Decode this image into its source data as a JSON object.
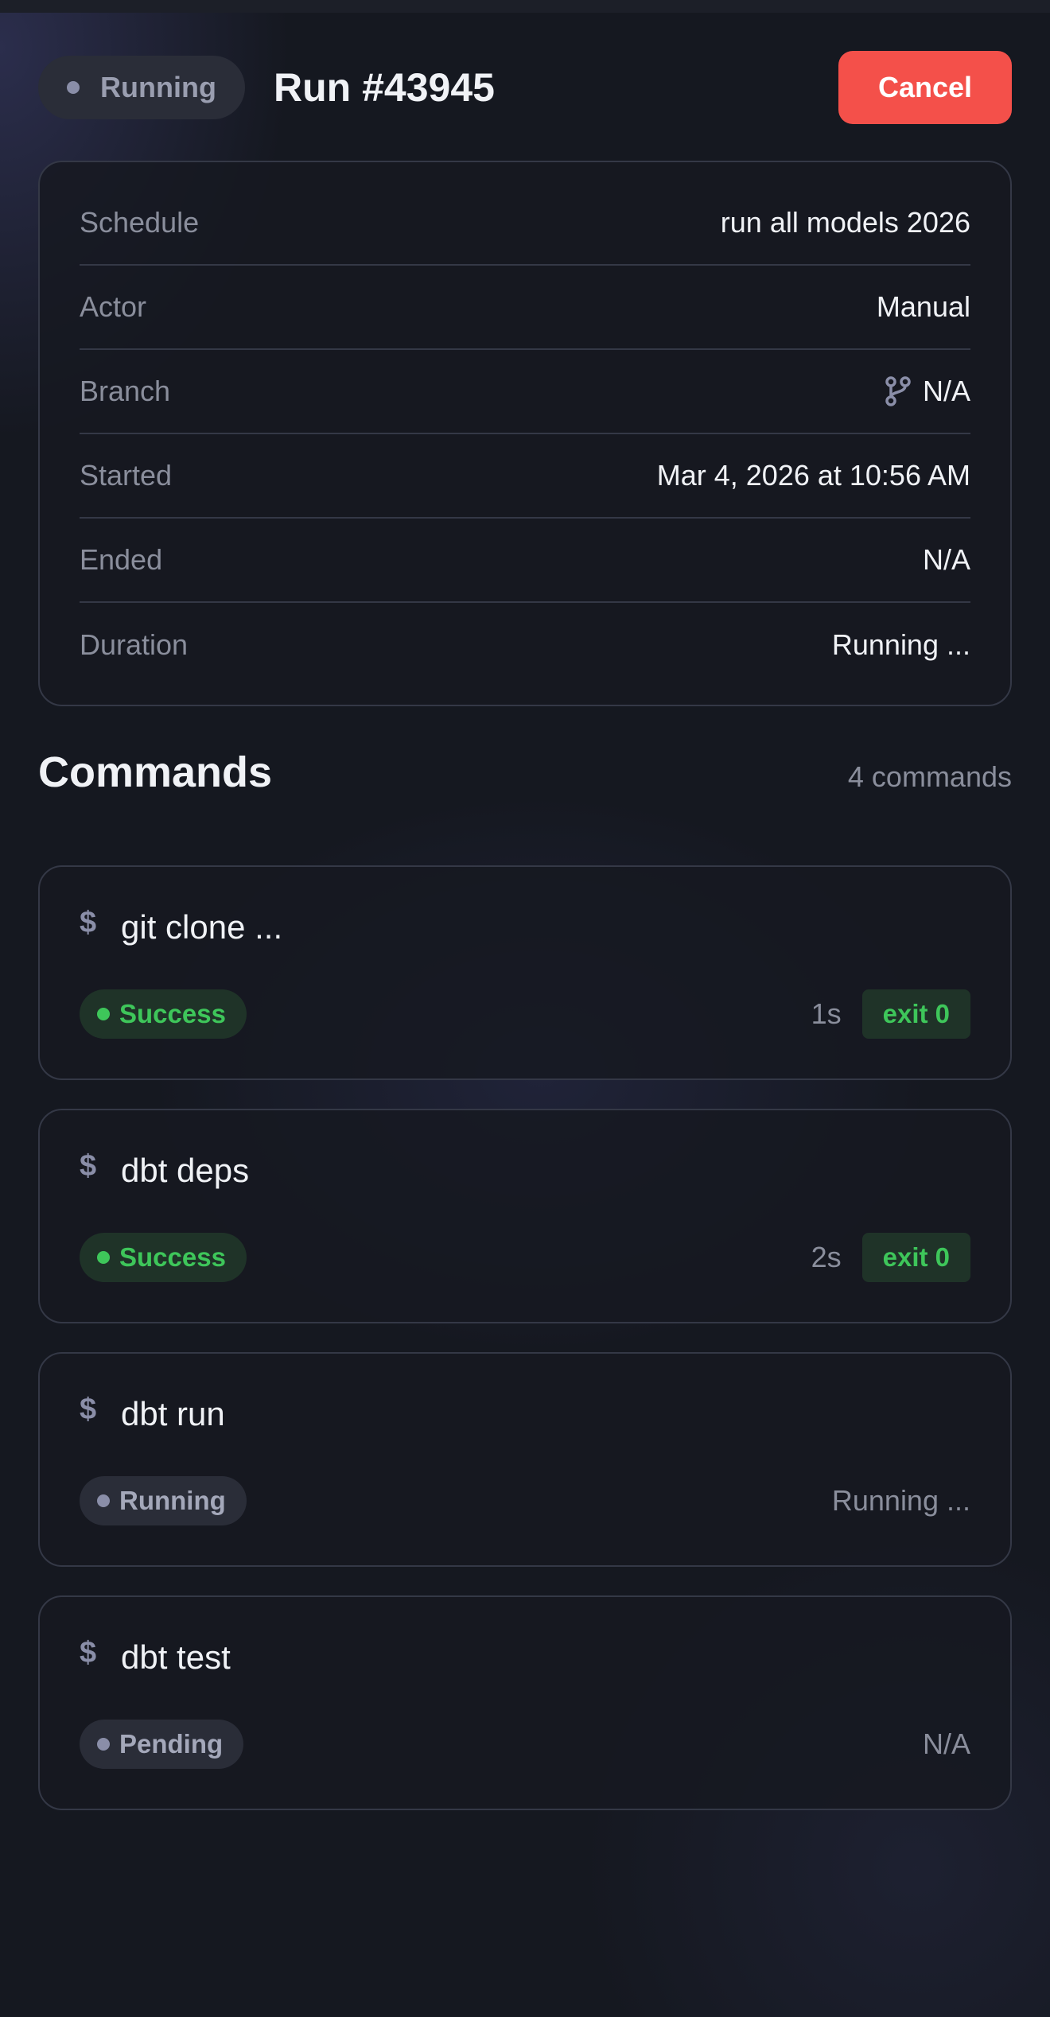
{
  "header": {
    "status": "Running",
    "title": "Run #43945",
    "cancel_label": "Cancel"
  },
  "details": [
    {
      "key": "Schedule",
      "value": "run all models 2026"
    },
    {
      "key": "Actor",
      "value": "Manual"
    },
    {
      "key": "Branch",
      "value": "N/A",
      "icon": "git-branch-icon"
    },
    {
      "key": "Started",
      "value": "Mar 4, 2026 at 10:56 AM"
    },
    {
      "key": "Ended",
      "value": "N/A"
    },
    {
      "key": "Duration",
      "value": "Running ..."
    }
  ],
  "commands": {
    "title": "Commands",
    "count_label": "4 commands",
    "items": [
      {
        "prompt": "$",
        "command": "git clone ...",
        "status": "Success",
        "duration": "1s",
        "exit": "exit 0"
      },
      {
        "prompt": "$",
        "command": "dbt deps",
        "status": "Success",
        "duration": "2s",
        "exit": "exit 0"
      },
      {
        "prompt": "$",
        "command": "dbt run",
        "status": "Running",
        "duration": "Running ..."
      },
      {
        "prompt": "$",
        "command": "dbt test",
        "status": "Pending",
        "duration": "N/A"
      }
    ]
  },
  "colors": {
    "background": "#151820",
    "cancel": "#f4504a",
    "success": "#3ec65a",
    "neutral": "#8a8ea8"
  }
}
